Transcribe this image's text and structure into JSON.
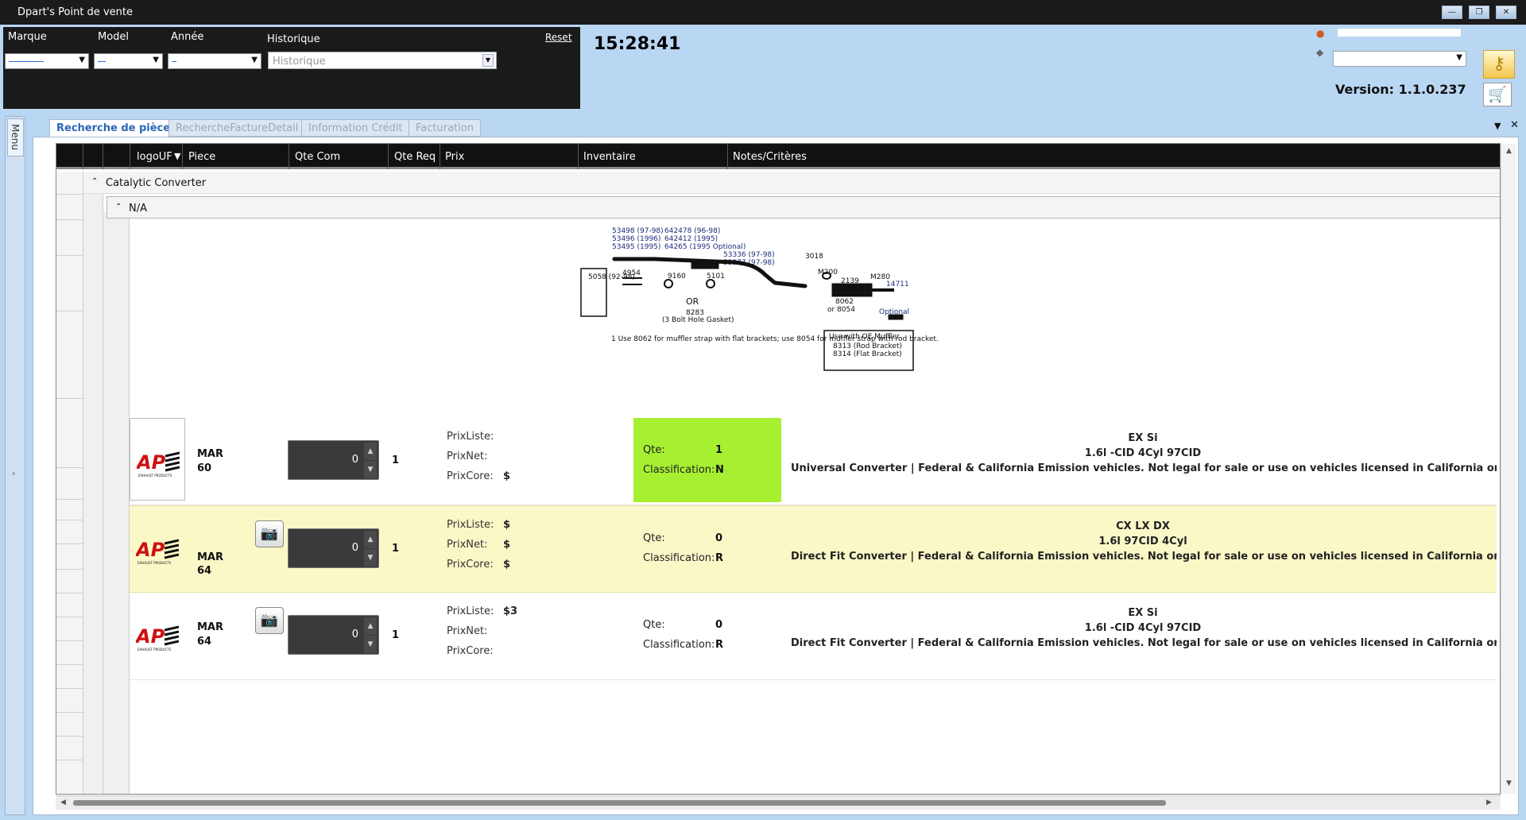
{
  "window": {
    "title": "Dpart's Point de vente"
  },
  "filters": {
    "marque_label": "Marque",
    "model_label": "Model",
    "annee_label": "Année",
    "historique_label": "Historique",
    "historique_placeholder": "Historique",
    "reset_label": "Reset"
  },
  "clock": "15:28:41",
  "version": "Version: 1.1.0.237",
  "icons": {
    "user": "user-icon",
    "store": "store-icon",
    "key": "key-icon",
    "cart": "cart-icon",
    "camera": "camera-icon"
  },
  "menu_label": "Menu",
  "tabs": [
    {
      "label": "Recherche de pièces",
      "active": true
    },
    {
      "label": "RechercheFactureDetail",
      "active": false
    },
    {
      "label": "Information Crédit",
      "active": false
    },
    {
      "label": "Facturation",
      "active": false
    }
  ],
  "grid": {
    "columns": [
      "logoUF",
      "Piece",
      "Qte Com",
      "Qte Req",
      "Prix",
      "Inventaire",
      "Notes/Critères"
    ],
    "group1": "Catalytic Converter",
    "group2": "N/A",
    "price_labels": [
      "PrixListe:",
      "PrixNet:",
      "PrixCore:"
    ],
    "inv_labels": {
      "qte": "Qte:",
      "classification": "Classification:"
    },
    "rows": [
      {
        "brand": "MAR",
        "part": "60",
        "qte_com": "0",
        "qte_req": "1",
        "prix_liste": "",
        "prix_net": "",
        "prix_core": "$",
        "qte": "1",
        "classification": "N",
        "in_stock": true,
        "trim": "EX Si",
        "engine": "1.6l -CID 4Cyl 97CID",
        "desc": "Universal Converter | Federal & California Emission vehicles. Not legal for sale or use on vehicles licensed in California or in states where CARB certification is required."
      },
      {
        "brand": "MAR",
        "part": "64",
        "qte_com": "0",
        "qte_req": "1",
        "prix_liste": "$",
        "prix_net": "$",
        "prix_core": "$",
        "qte": "0",
        "classification": "R",
        "in_stock": false,
        "trim": "CX LX DX",
        "engine": "1.6l 97CID 4Cyl",
        "desc": "Direct Fit Converter | Federal & California Emission vehicles. Not legal for sale or use on vehicles licensed in California or in states where CARB certification is required."
      },
      {
        "brand": "MAR",
        "part": "64",
        "qte_com": "0",
        "qte_req": "1",
        "prix_liste": "$3",
        "prix_net": "",
        "prix_core": "",
        "qte": "0",
        "classification": "R",
        "in_stock": false,
        "trim": "EX Si",
        "engine": "1.6l -CID 4Cyl 97CID",
        "desc": "Direct Fit Converter | Federal & California Emission vehicles. Not legal for sale or use on vehicles licensed in California or in states where CARB certification is required."
      }
    ]
  },
  "diagram": {
    "labels": [
      "53498 (97-98)",
      "53496 (1996)",
      "53495 (1995)",
      "642478 (96-98)",
      "642412 (1995)",
      "64265 (1995 Optional)",
      "53336 (97-98)",
      "53377 (97-98)",
      "3018",
      "5058 (92-98)",
      "4954",
      "9160",
      "5101",
      "M200",
      "2139",
      "M280",
      "14711",
      "OR",
      "8283",
      "(3 Bolt Hole Gasket)",
      "8062",
      "or 8054",
      "Optional",
      "1 Use 8062 for muffler strap with flat brackets; use 8054 for muffler strap with rod bracket.",
      "Use with OE Muffler",
      "8313 (Rod Bracket)",
      "8314 (Flat Bracket)"
    ]
  },
  "colors": {
    "header_bg": "#b9d6f2",
    "filter_bg": "#1a1a1a",
    "in_stock": "#a6f031",
    "highlight_row": "#fbf8c8",
    "tab_active": "#2a67b7"
  }
}
